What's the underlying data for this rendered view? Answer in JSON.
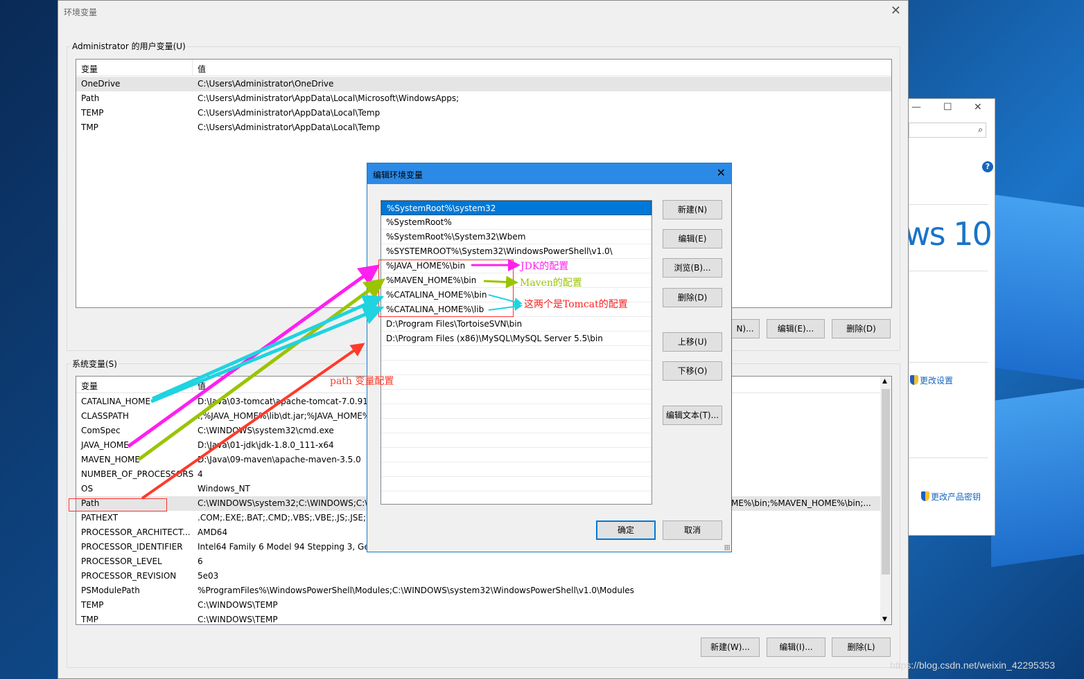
{
  "main_window": {
    "title": "环境变量",
    "user_group_label": "Administrator 的用户变量(U)",
    "system_group_label": "系统变量(S)",
    "col_variable": "变量",
    "col_value": "值",
    "user_vars": [
      {
        "name": "OneDrive",
        "value": "C:\\Users\\Administrator\\OneDrive"
      },
      {
        "name": "Path",
        "value": "C:\\Users\\Administrator\\AppData\\Local\\Microsoft\\WindowsApps;"
      },
      {
        "name": "TEMP",
        "value": "C:\\Users\\Administrator\\AppData\\Local\\Temp"
      },
      {
        "name": "TMP",
        "value": "C:\\Users\\Administrator\\AppData\\Local\\Temp"
      }
    ],
    "user_buttons": {
      "new_partial": "N)...",
      "edit": "编辑(E)...",
      "delete": "删除(D)"
    },
    "system_vars": [
      {
        "name": "CATALINA_HOME",
        "value": "D:\\Java\\03-tomcat\\apache-tomcat-7.0.91-v"
      },
      {
        "name": "CLASSPATH",
        "value": ".;%JAVA_HOME%\\lib\\dt.jar;%JAVA_HOME%"
      },
      {
        "name": "ComSpec",
        "value": "C:\\WINDOWS\\system32\\cmd.exe"
      },
      {
        "name": "JAVA_HOME",
        "value": "D:\\Java\\01-jdk\\jdk-1.8.0_111-x64"
      },
      {
        "name": "MAVEN_HOME",
        "value": "D:\\Java\\09-maven\\apache-maven-3.5.0"
      },
      {
        "name": "NUMBER_OF_PROCESSORS",
        "value": "4"
      },
      {
        "name": "OS",
        "value": "Windows_NT"
      },
      {
        "name": "Path",
        "value": "C:\\WINDOWS\\system32;C:\\WINDOWS;C:\\W",
        "value_tail": "ME%\\bin;%MAVEN_HOME%\\bin;..."
      },
      {
        "name": "PATHEXT",
        "value": ".COM;.EXE;.BAT;.CMD;.VBS;.VBE;.JS;.JSE;.W"
      },
      {
        "name": "PROCESSOR_ARCHITECT...",
        "value": "AMD64"
      },
      {
        "name": "PROCESSOR_IDENTIFIER",
        "value": "Intel64 Family 6 Model 94 Stepping 3, Ger"
      },
      {
        "name": "PROCESSOR_LEVEL",
        "value": "6"
      },
      {
        "name": "PROCESSOR_REVISION",
        "value": "5e03"
      },
      {
        "name": "PSModulePath",
        "value": "%ProgramFiles%\\WindowsPowerShell\\Modules;C:\\WINDOWS\\system32\\WindowsPowerShell\\v1.0\\Modules"
      },
      {
        "name": "TEMP",
        "value": "C:\\WINDOWS\\TEMP"
      },
      {
        "name": "TMP",
        "value": "C:\\WINDOWS\\TEMP"
      }
    ],
    "system_buttons": {
      "new": "新建(W)...",
      "edit": "编辑(I)...",
      "delete": "删除(L)"
    }
  },
  "edit_dialog": {
    "title": "编辑环境变量",
    "entries": [
      "%SystemRoot%\\system32",
      "%SystemRoot%",
      "%SystemRoot%\\System32\\Wbem",
      "%SYSTEMROOT%\\System32\\WindowsPowerShell\\v1.0\\",
      "%JAVA_HOME%\\bin",
      "%MAVEN_HOME%\\bin",
      "%CATALINA_HOME%\\bin",
      "%CATALINA_HOME%\\lib",
      "D:\\Program Files\\TortoiseSVN\\bin",
      "D:\\Program Files (x86)\\MySQL\\MySQL Server 5.5\\bin"
    ],
    "selected_index": 0,
    "buttons": {
      "new": "新建(N)",
      "edit": "编辑(E)",
      "browse": "浏览(B)...",
      "delete": "删除(D)",
      "up": "上移(U)",
      "down": "下移(O)",
      "edit_text": "编辑文本(T)...",
      "ok": "确定",
      "cancel": "取消"
    }
  },
  "background_window": {
    "brand_partial": "ws 10",
    "link_change_settings": "更改设置",
    "link_product_key": "更改产品密钥"
  },
  "annotations": {
    "jdk": "JDK的配置",
    "maven": "Maven的配置",
    "tomcat": "这两个是Tomcat的配置",
    "path": "path 变量配置",
    "colors": {
      "jdk": "#ff1ff0",
      "maven": "#9ac400",
      "tomcat": "#1fd3e0",
      "path": "#ff3a2a"
    }
  },
  "watermark": "https://blog.csdn.net/weixin_42295353"
}
